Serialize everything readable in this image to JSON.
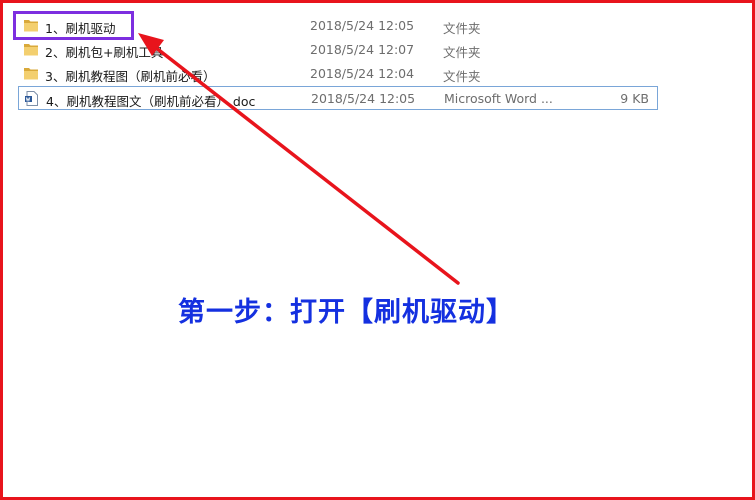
{
  "files": [
    {
      "name": "1、刷机驱动",
      "date": "2018/5/24 12:05",
      "type": "文件夹",
      "size": "",
      "icon": "folder-icon"
    },
    {
      "name": "2、刷机包+刷机工具",
      "date": "2018/5/24 12:07",
      "type": "文件夹",
      "size": "",
      "icon": "folder-icon"
    },
    {
      "name": "3、刷机教程图（刷机前必看）",
      "date": "2018/5/24 12:04",
      "type": "文件夹",
      "size": "",
      "icon": "folder-icon"
    },
    {
      "name": "4、刷机教程图文（刷机前必看）.doc",
      "date": "2018/5/24 12:05",
      "type": "Microsoft Word ...",
      "size": "9 KB",
      "icon": "word-document-icon"
    }
  ],
  "annotation": {
    "instruction": "第一步：打开【刷机驱动】"
  },
  "colors": {
    "frame_border": "#e8141c",
    "highlight_box": "#7d2ee0",
    "arrow": "#e8141c",
    "instruction_text": "#1430e0",
    "folder": "#e8c56a",
    "selection_border": "#7aa6d8"
  }
}
